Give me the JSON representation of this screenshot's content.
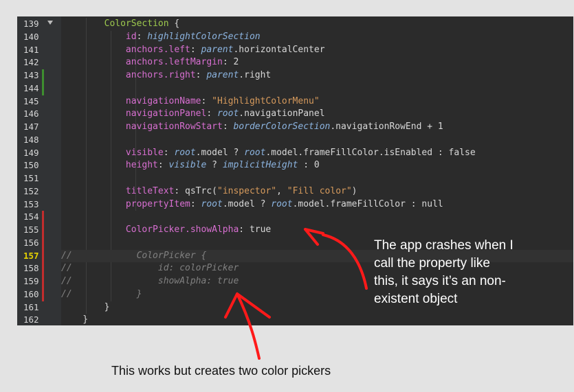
{
  "colors": {
    "gutter_bg": "#313335",
    "editor_bg": "#2b2b2b",
    "keyword": "#d69545",
    "type": "#a9b7c6",
    "qml_type": "#9eca4e",
    "property": "#d86fd1",
    "string": "#d69a5c",
    "italic_ref": "#8cb4e0",
    "comment": "#808080",
    "arrow": "#ff0000"
  },
  "editor": {
    "lines": [
      {
        "num": "139",
        "fold": true,
        "marker": null,
        "tokens": [
          {
            "t": "        "
          },
          {
            "t": "ColorSection",
            "c": "qml"
          },
          {
            "t": " {",
            "c": "plain"
          }
        ]
      },
      {
        "num": "140",
        "marker": null,
        "tokens": [
          {
            "t": "            "
          },
          {
            "t": "id",
            "c": "prop"
          },
          {
            "t": ": "
          },
          {
            "t": "highlightColorSection",
            "c": "ref"
          }
        ]
      },
      {
        "num": "141",
        "marker": null,
        "tokens": [
          {
            "t": "            "
          },
          {
            "t": "anchors.left",
            "c": "prop"
          },
          {
            "t": ": "
          },
          {
            "t": "parent",
            "c": "ref"
          },
          {
            "t": ".horizontalCenter"
          }
        ]
      },
      {
        "num": "142",
        "marker": null,
        "tokens": [
          {
            "t": "            "
          },
          {
            "t": "anchors.leftMargin",
            "c": "prop"
          },
          {
            "t": ": 2"
          }
        ]
      },
      {
        "num": "143",
        "marker": "green",
        "tokens": [
          {
            "t": "            "
          },
          {
            "t": "anchors.right",
            "c": "prop"
          },
          {
            "t": ": "
          },
          {
            "t": "parent",
            "c": "ref"
          },
          {
            "t": ".right"
          }
        ]
      },
      {
        "num": "144",
        "marker": "green",
        "tokens": []
      },
      {
        "num": "145",
        "marker": null,
        "tokens": [
          {
            "t": "            "
          },
          {
            "t": "navigationName",
            "c": "prop"
          },
          {
            "t": ": "
          },
          {
            "t": "\"HighlightColorMenu\"",
            "c": "str"
          }
        ]
      },
      {
        "num": "146",
        "marker": null,
        "tokens": [
          {
            "t": "            "
          },
          {
            "t": "navigationPanel",
            "c": "prop"
          },
          {
            "t": ": "
          },
          {
            "t": "root",
            "c": "ref"
          },
          {
            "t": ".navigationPanel"
          }
        ]
      },
      {
        "num": "147",
        "marker": null,
        "tokens": [
          {
            "t": "            "
          },
          {
            "t": "navigationRowStart",
            "c": "prop"
          },
          {
            "t": ": "
          },
          {
            "t": "borderColorSection",
            "c": "ref"
          },
          {
            "t": ".navigationRowEnd + 1"
          }
        ]
      },
      {
        "num": "148",
        "marker": null,
        "tokens": []
      },
      {
        "num": "149",
        "marker": null,
        "tokens": [
          {
            "t": "            "
          },
          {
            "t": "visible",
            "c": "prop"
          },
          {
            "t": ": "
          },
          {
            "t": "root",
            "c": "ref"
          },
          {
            "t": ".model ? "
          },
          {
            "t": "root",
            "c": "ref"
          },
          {
            "t": ".model.frameFillColor.isEnabled : false"
          }
        ]
      },
      {
        "num": "150",
        "marker": null,
        "tokens": [
          {
            "t": "            "
          },
          {
            "t": "height",
            "c": "prop"
          },
          {
            "t": ": "
          },
          {
            "t": "visible",
            "c": "ref"
          },
          {
            "t": " ? "
          },
          {
            "t": "implicitHeight",
            "c": "ref"
          },
          {
            "t": " : 0"
          }
        ]
      },
      {
        "num": "151",
        "marker": null,
        "tokens": []
      },
      {
        "num": "152",
        "marker": null,
        "tokens": [
          {
            "t": "            "
          },
          {
            "t": "titleText",
            "c": "prop"
          },
          {
            "t": ": qsTrc("
          },
          {
            "t": "\"inspector\"",
            "c": "str"
          },
          {
            "t": ", "
          },
          {
            "t": "\"Fill color\"",
            "c": "str"
          },
          {
            "t": ")"
          }
        ]
      },
      {
        "num": "153",
        "marker": null,
        "tokens": [
          {
            "t": "            "
          },
          {
            "t": "propertyItem",
            "c": "prop"
          },
          {
            "t": ": "
          },
          {
            "t": "root",
            "c": "ref"
          },
          {
            "t": ".model ? "
          },
          {
            "t": "root",
            "c": "ref"
          },
          {
            "t": ".model.frameFillColor : null"
          }
        ]
      },
      {
        "num": "154",
        "marker": "red",
        "tokens": []
      },
      {
        "num": "155",
        "marker": "red",
        "tokens": [
          {
            "t": "            "
          },
          {
            "t": "ColorPicker.showAlpha",
            "c": "prop"
          },
          {
            "t": ": true"
          }
        ]
      },
      {
        "num": "156",
        "marker": "red",
        "tokens": []
      },
      {
        "num": "157",
        "marker": "red",
        "current": true,
        "tokens": [
          {
            "t": "//",
            "c": "cmt"
          },
          {
            "t": "            ColorPicker {",
            "c": "cmt"
          }
        ]
      },
      {
        "num": "158",
        "marker": "red",
        "tokens": [
          {
            "t": "//",
            "c": "cmt"
          },
          {
            "t": "                id: colorPicker",
            "c": "cmt"
          }
        ]
      },
      {
        "num": "159",
        "marker": "red",
        "tokens": [
          {
            "t": "//",
            "c": "cmt"
          },
          {
            "t": "                showAlpha: true",
            "c": "cmt"
          }
        ]
      },
      {
        "num": "160",
        "marker": "red",
        "tokens": [
          {
            "t": "//",
            "c": "cmt"
          },
          {
            "t": "            }",
            "c": "cmt"
          }
        ]
      },
      {
        "num": "161",
        "marker": null,
        "tokens": [
          {
            "t": "        }"
          }
        ]
      },
      {
        "num": "162",
        "marker": null,
        "tokens": [
          {
            "t": "    }"
          }
        ]
      }
    ]
  },
  "annotations": {
    "right_note": [
      "The app crashes when I",
      "call the property like",
      "this, it says it’s an non-",
      "existent object"
    ],
    "bottom_caption": "This works but creates two color pickers"
  }
}
